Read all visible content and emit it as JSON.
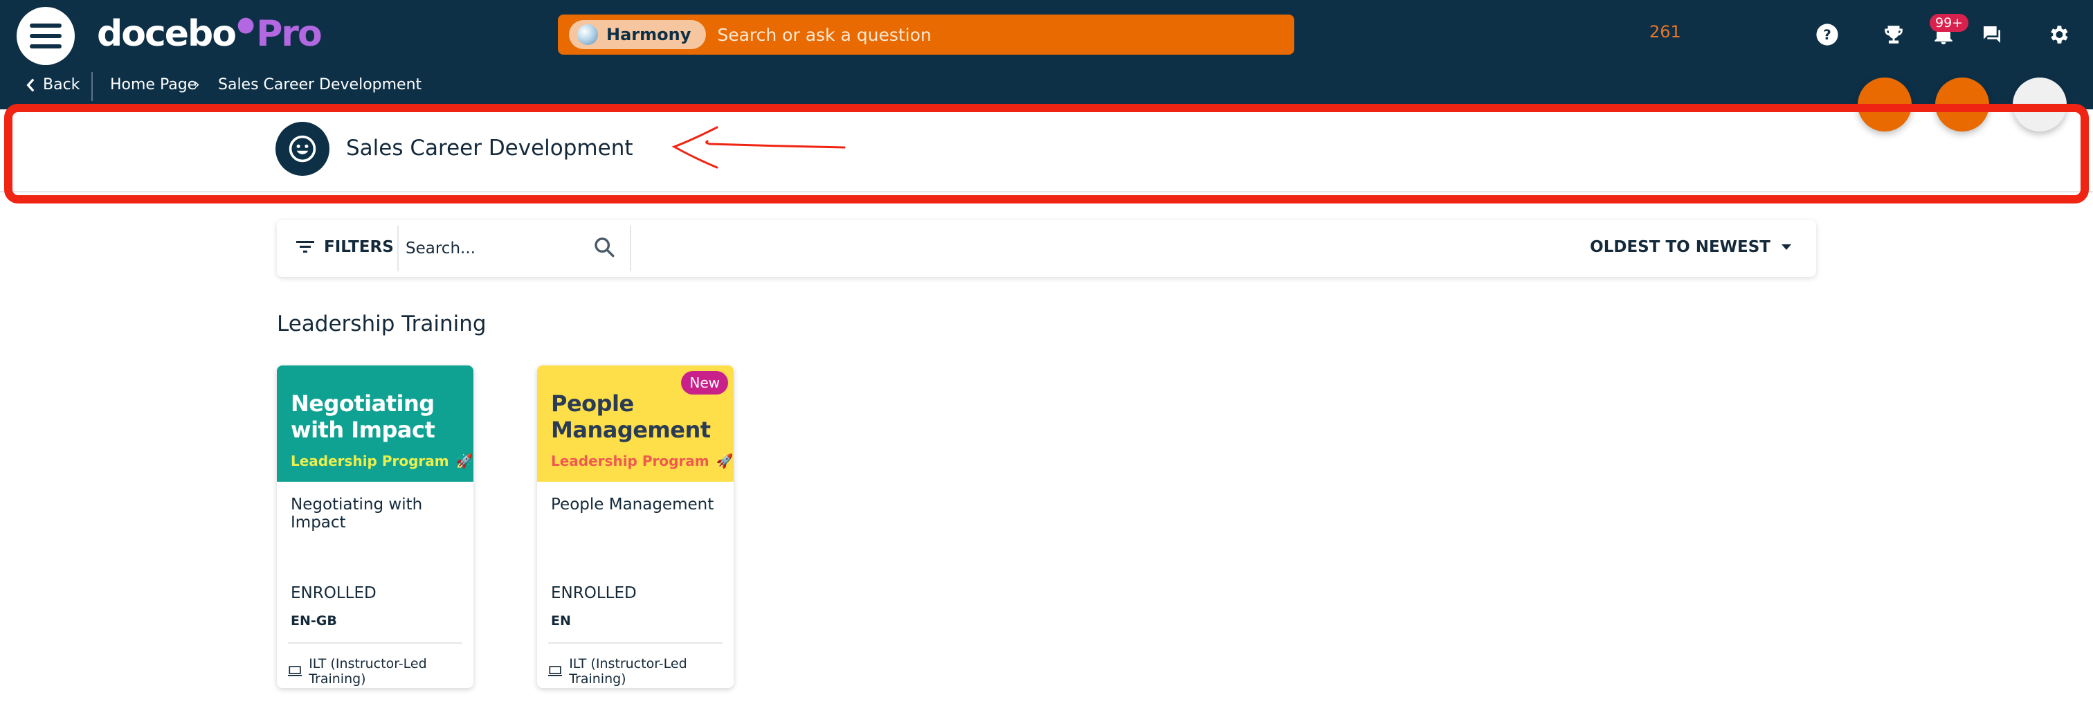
{
  "header": {
    "logo_word": "docebo",
    "logo_pro": "Pro",
    "search": {
      "assistant_label": "Harmony",
      "placeholder": "Search or ask a question"
    },
    "counter": "261",
    "notification_badge": "99+",
    "icons": [
      "menu-icon",
      "help-icon",
      "trophy-icon",
      "bell-icon",
      "chat-icon",
      "gear-icon"
    ]
  },
  "breadcrumb": {
    "back_label": "Back",
    "items": [
      "Home Page",
      "Sales Career Development"
    ]
  },
  "page": {
    "title": "Sales Career Development",
    "avatar_icon": "smiley-icon"
  },
  "filters": {
    "filters_label": "FILTERS",
    "search_placeholder": "Search...",
    "sort_label": "OLDEST TO NEWEST"
  },
  "section": {
    "title": "Leadership Training",
    "cards": [
      {
        "thumb_title_line1": "Negotiating",
        "thumb_title_line2": "with Impact",
        "thumb_subtitle": "Leadership Program",
        "name": "Negotiating with Impact",
        "status": "ENROLLED",
        "language": "EN-GB",
        "type": "ILT (Instructor-Led Training)",
        "color": "#0fa293"
      },
      {
        "thumb_title_line1": "People",
        "thumb_title_line2": "Management",
        "thumb_subtitle": "Leadership Program",
        "badge": "New",
        "name": "People Management",
        "status": "ENROLLED",
        "language": "EN",
        "type": "ILT (Instructor-Led Training)",
        "color": "#fedf4a"
      }
    ]
  },
  "colors": {
    "navy": "#0d3047",
    "orange": "#e86a00",
    "accent_purple": "#b268e0",
    "annotation_red": "#f02413",
    "badge_red": "#d9214e",
    "badge_magenta": "#c8218a"
  }
}
